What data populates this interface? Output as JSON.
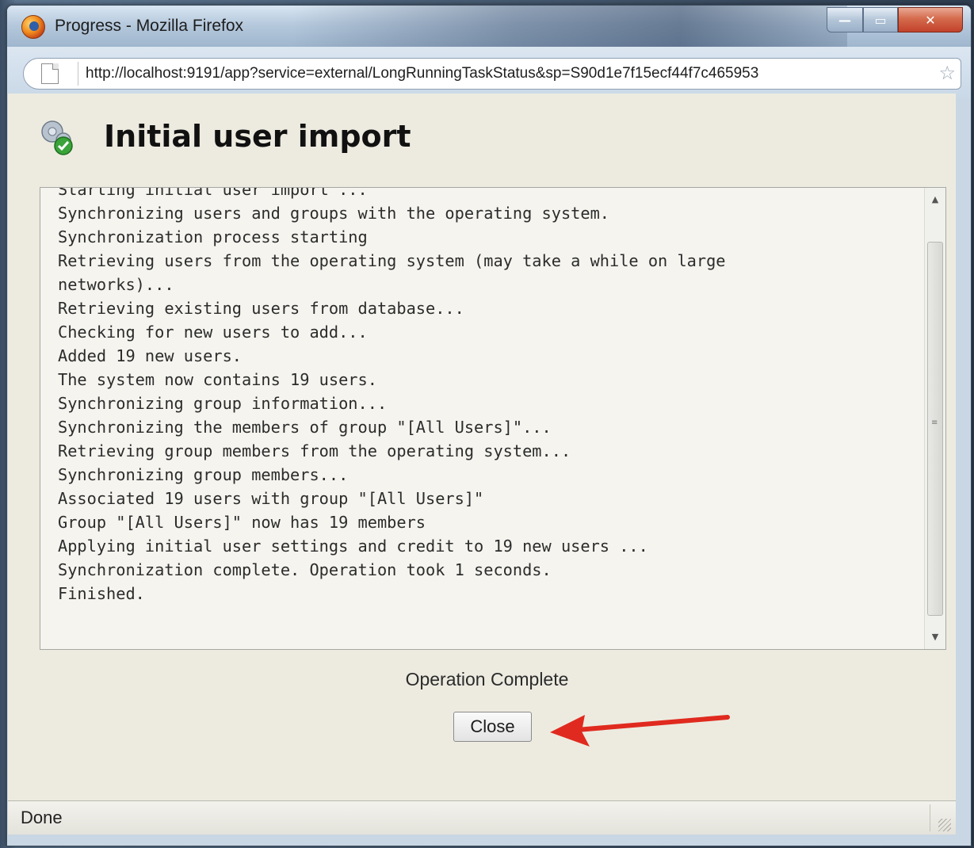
{
  "window": {
    "title": "Progress - Mozilla Firefox",
    "controls": {
      "minimize": "—",
      "maximize": "▭",
      "close": "✕"
    }
  },
  "urlbar": {
    "url": "http://localhost:9191/app?service=external/LongRunningTaskStatus&sp=S90d1e7f15ecf44f7c465953"
  },
  "page": {
    "heading": "Initial user import",
    "log_lines": [
      "Starting initial user import ...",
      "Synchronizing users and groups with the operating system.",
      "Synchronization process starting",
      "Retrieving users from the operating system (may take a while on large",
      "networks)...",
      "Retrieving existing users from database...",
      "Checking for new users to add...",
      "Added 19 new users.",
      "The system now contains 19 users.",
      "Synchronizing group information...",
      "Synchronizing the members of group \"[All Users]\"...",
      "Retrieving group members from the operating system...",
      "Synchronizing group members...",
      "Associated 19 users with group \"[All Users]\"",
      "Group \"[All Users]\" now has 19 members",
      "Applying initial user settings and credit to 19 new users ...",
      "Synchronization complete. Operation took 1 seconds.",
      "Finished."
    ],
    "status_message": "Operation Complete",
    "close_button": "Close"
  },
  "statusbar": {
    "text": "Done"
  },
  "colors": {
    "page_bg": "#edebe0",
    "arrow": "#e02a1f",
    "check": "#3aa33a"
  }
}
